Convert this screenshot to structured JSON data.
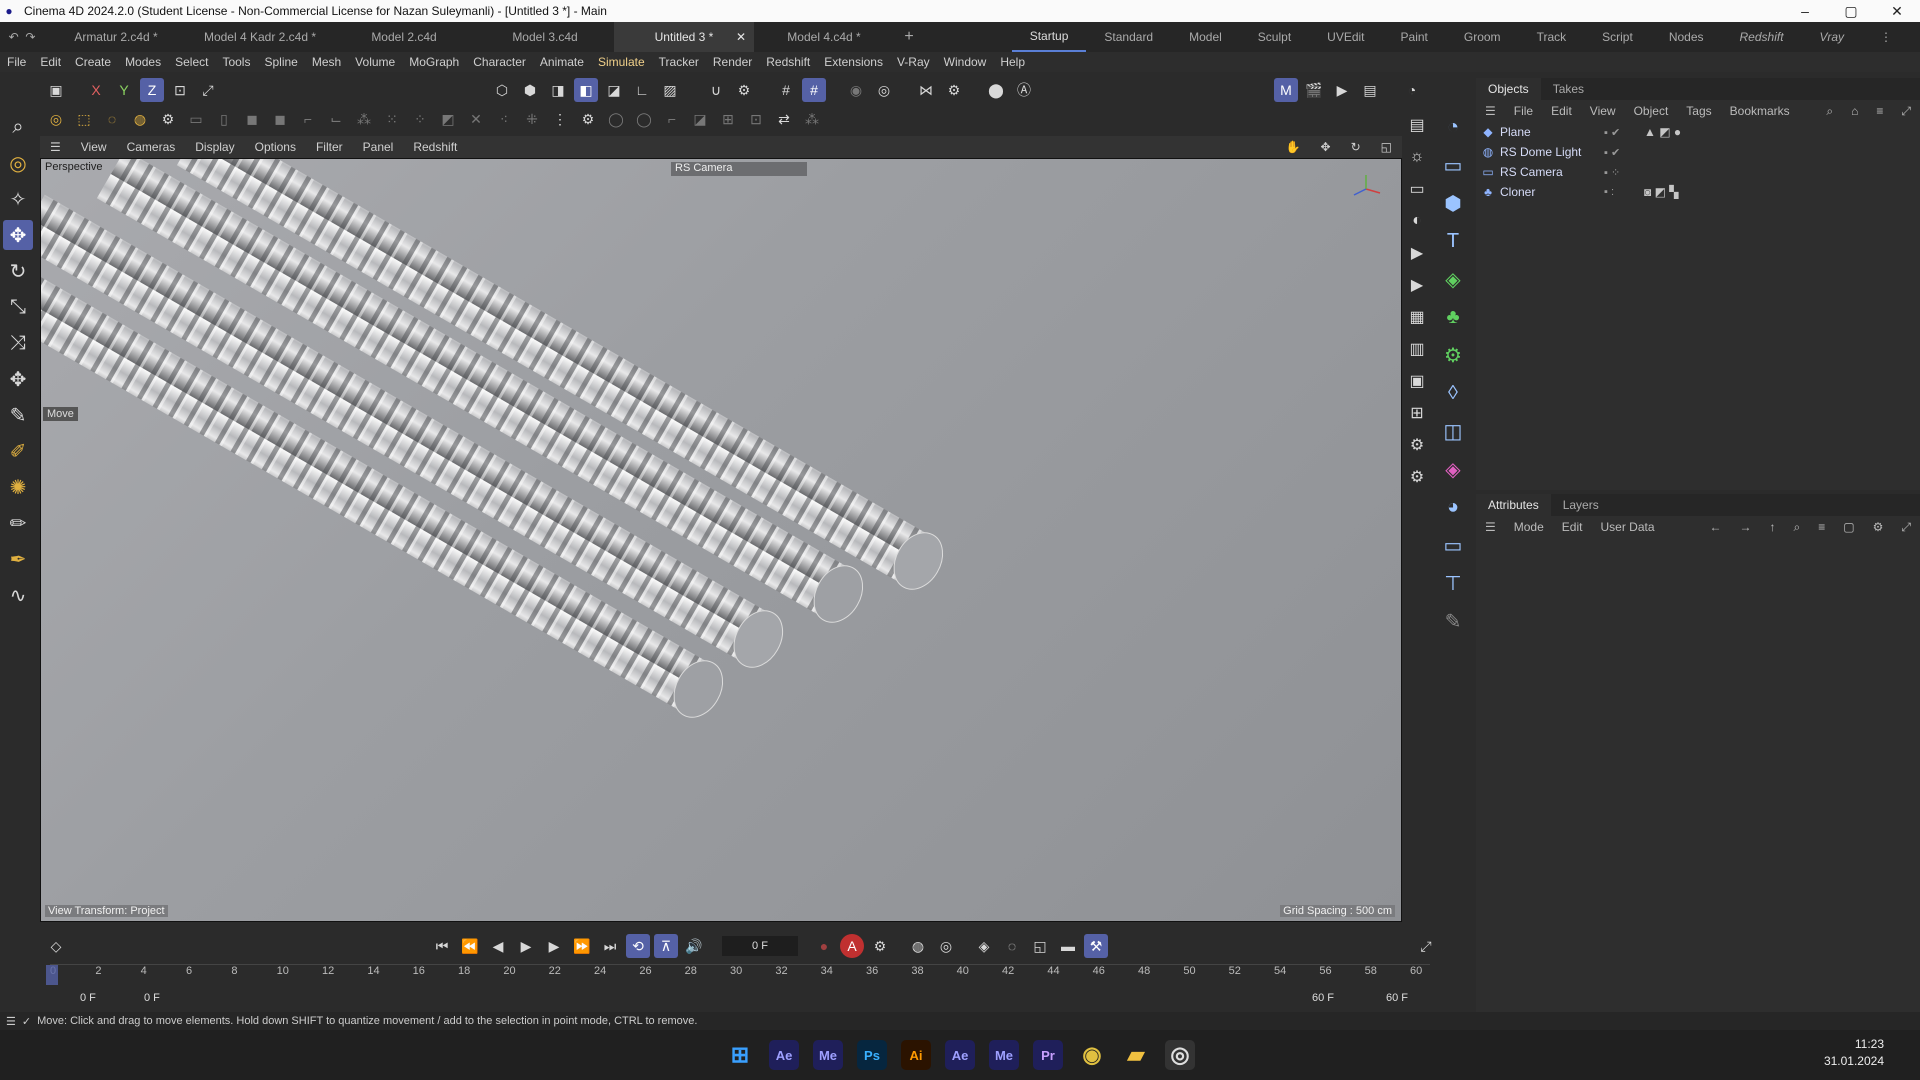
{
  "window": {
    "title": "Cinema 4D 2024.2.0 (Student License - Non-Commercial License for Nazan Suleymanli) - [Untitled 3 *] - Main"
  },
  "doc_tabs": [
    {
      "label": "Armatur 2.c4d *"
    },
    {
      "label": "Model 4 Kadr 2.c4d *"
    },
    {
      "label": "Model 2.c4d"
    },
    {
      "label": "Model 3.c4d"
    },
    {
      "label": "Untitled 3 *"
    },
    {
      "label": "Model 4.c4d *"
    }
  ],
  "layouts": [
    "Startup",
    "Standard",
    "Model",
    "Sculpt",
    "UVEdit",
    "Paint",
    "Groom",
    "Track",
    "Script",
    "Nodes",
    "Redshift",
    "Vray"
  ],
  "menu": [
    "File",
    "Edit",
    "Create",
    "Modes",
    "Select",
    "Tools",
    "Spline",
    "Mesh",
    "Volume",
    "MoGraph",
    "Character",
    "Animate",
    "Simulate",
    "Tracker",
    "Render",
    "Redshift",
    "Extensions",
    "V-Ray",
    "Window",
    "Help"
  ],
  "viewport": {
    "menu": [
      "View",
      "Cameras",
      "Display",
      "Options",
      "Filter",
      "Panel",
      "Redshift"
    ],
    "mode_label": "Perspective",
    "camera_label": "RS Camera",
    "move_label": "Move",
    "view_transform": "View Transform: Project",
    "grid_spacing": "Grid Spacing : 500 cm"
  },
  "objects_panel": {
    "tabs": [
      "Objects",
      "Takes"
    ],
    "menu": [
      "File",
      "Edit",
      "View",
      "Object",
      "Tags",
      "Bookmarks"
    ],
    "items": [
      {
        "name": "Plane",
        "icon": "plane-icon"
      },
      {
        "name": "RS Dome Light",
        "icon": "dome-light-icon"
      },
      {
        "name": "RS Camera",
        "icon": "camera-icon"
      },
      {
        "name": "Cloner",
        "icon": "cloner-icon"
      }
    ]
  },
  "attributes_panel": {
    "tabs": [
      "Attributes",
      "Layers"
    ],
    "menu": [
      "Mode",
      "Edit",
      "User Data"
    ]
  },
  "timeline": {
    "current_frame": "0 F",
    "start": "0 F",
    "start2": "0 F",
    "end": "60 F",
    "end2": "60 F",
    "ticks": [
      "0",
      "2",
      "4",
      "6",
      "8",
      "10",
      "12",
      "14",
      "16",
      "18",
      "20",
      "22",
      "24",
      "26",
      "28",
      "30",
      "32",
      "34",
      "36",
      "38",
      "40",
      "42",
      "44",
      "46",
      "48",
      "50",
      "52",
      "54",
      "56",
      "58",
      "60"
    ]
  },
  "status": {
    "text": "Move: Click and drag to move elements. Hold down SHIFT to quantize movement / add to the selection in point mode, CTRL to remove."
  },
  "taskbar": {
    "apps": [
      "Ae",
      "Me",
      "Ps",
      "Ai",
      "Ae",
      "Me",
      "Pr"
    ],
    "time": "11:23",
    "date": "31.01.2024"
  },
  "colors": {
    "accent": "#5561a6",
    "highlight": "#f0d08a"
  }
}
